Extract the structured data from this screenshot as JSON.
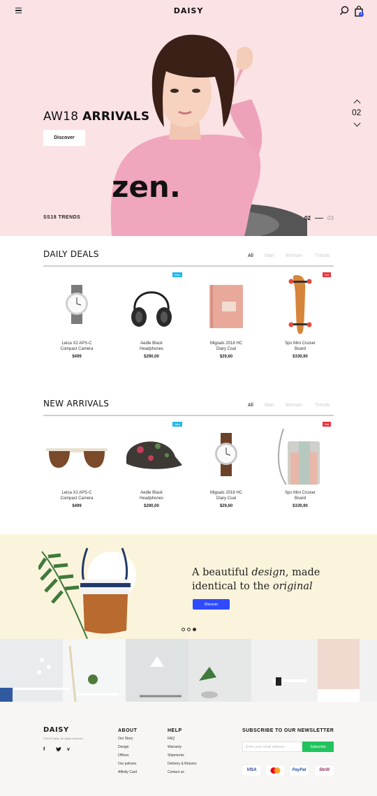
{
  "header": {
    "logo": "DAISY",
    "cart_count": "1"
  },
  "hero": {
    "title_light": "AW18",
    "title_bold": "ARRIVALS",
    "button_label": "Discover",
    "trend_label": "SS18 TRENDS",
    "slide_current": "02",
    "slide_next": "03",
    "vertical_slide": "02",
    "sweater_text": "zen."
  },
  "daily_deals": {
    "title": "DAILY DEALS",
    "tabs": [
      "All",
      "Man",
      "Woman",
      "Trends"
    ],
    "products": [
      {
        "name_line1": "Leica X2 APS-C",
        "name_line2": "Compact Camera",
        "price": "$499",
        "tag": ""
      },
      {
        "name_line1": "Aedle Black",
        "name_line2": "Headphones",
        "price": "$290,00",
        "tag": "New"
      },
      {
        "name_line1": "Migoals 2018 HC",
        "name_line2": "Diary Coal",
        "price": "$29,60",
        "tag": ""
      },
      {
        "name_line1": "Sps Mini Cruiser",
        "name_line2": "Board",
        "price": "$339,90",
        "tag": "Hot"
      }
    ]
  },
  "new_arrivals": {
    "title": "NEW ARRIVALS",
    "tabs": [
      "All",
      "Man",
      "Woman",
      "Trends"
    ],
    "products": [
      {
        "name_line1": "Leica X2 APS-C",
        "name_line2": "Compact Camera",
        "price": "$499",
        "tag": ""
      },
      {
        "name_line1": "Aedle Black",
        "name_line2": "Headphones",
        "price": "$290,00",
        "tag": "New"
      },
      {
        "name_line1": "Migoals 2018 HC",
        "name_line2": "Diary Coal",
        "price": "$29,60",
        "tag": ""
      },
      {
        "name_line1": "Sps Mini Cruiser",
        "name_line2": "Board",
        "price": "$339,90",
        "tag": "Hot"
      }
    ]
  },
  "promo": {
    "line1_start": "A beautiful ",
    "line1_em": "design",
    "line1_end": ", made",
    "line2_start": "identical to the ",
    "line2_em": "original",
    "button_label": "Discover"
  },
  "footer": {
    "logo": "DAISY",
    "copyright": "©2018 Daisy. All rights reserved",
    "social": [
      "f",
      "t",
      "v"
    ],
    "about": {
      "title": "ABOUT",
      "links": [
        "Our Story",
        "Design",
        "Offices",
        "Our policies",
        "Affinity Card"
      ]
    },
    "help": {
      "title": "HELP",
      "links": [
        "FAQ",
        "Warranty",
        "Shipments",
        "Delivery & Returns",
        "Contact us"
      ]
    },
    "newsletter": {
      "title": "SUBSCRIBE TO OUR NEWSLETTER",
      "placeholder": "Enter your email address",
      "button_label": "Subscribe"
    },
    "payments": [
      "VISA",
      "",
      "PayPal",
      "Skrill"
    ]
  },
  "colors": {
    "hero_bg": "#fbe2e4",
    "accent_blue": "#2f4bff",
    "accent_green": "#22c35e",
    "tag_new": "#20b8e8",
    "tag_hot": "#e8343f",
    "promo_bg": "#fbf4dc"
  }
}
